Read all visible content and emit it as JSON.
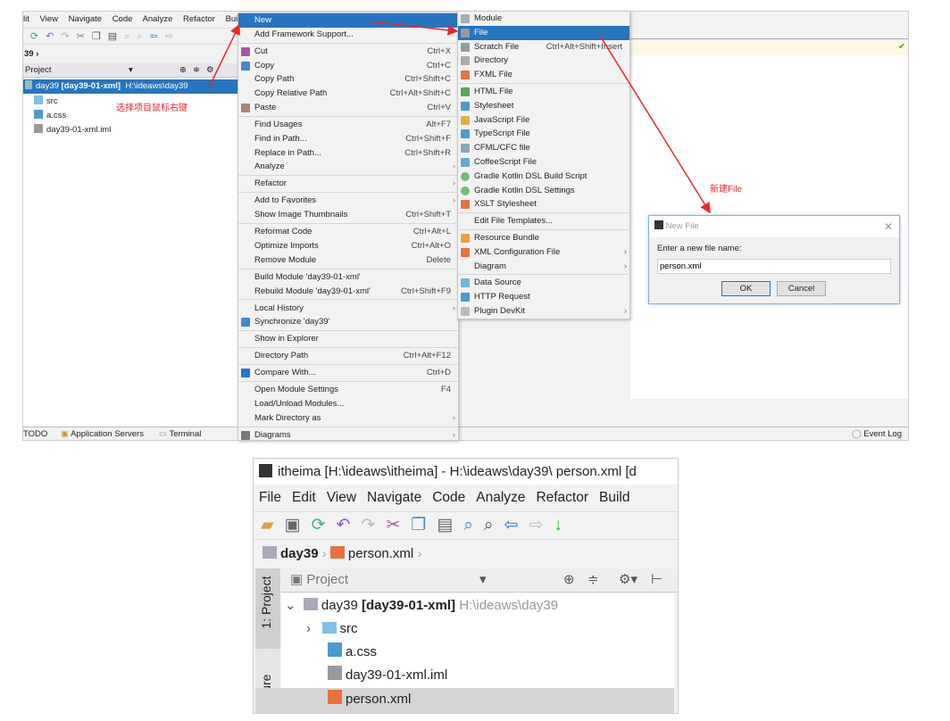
{
  "top_window": {
    "menubar": [
      "lit",
      "View",
      "Navigate",
      "Code",
      "Analyze",
      "Refactor",
      "Buil"
    ],
    "breadcrumb": "39",
    "project_header": "Project",
    "tree": {
      "root_name": "day39",
      "root_module": "[day39-01-xml]",
      "root_path": "H:\\ideaws\\day39",
      "items": [
        "src",
        "a.css",
        "day39-01-xml.iml"
      ]
    },
    "status_bar": {
      "todo": "TODO",
      "app_servers": "Application Servers",
      "terminal": "Terminal",
      "event_log": "Event Log"
    }
  },
  "context_menu": [
    {
      "label": "New",
      "arrow": true,
      "selected": true
    },
    {
      "label": "Add Framework Support..."
    },
    {
      "sep": true
    },
    {
      "label": "Cut",
      "shortcut": "Ctrl+X",
      "icon": "scissors-icon"
    },
    {
      "label": "Copy",
      "shortcut": "Ctrl+C",
      "icon": "copy-icon"
    },
    {
      "label": "Copy Path",
      "shortcut": "Ctrl+Shift+C"
    },
    {
      "label": "Copy Relative Path",
      "shortcut": "Ctrl+Alt+Shift+C"
    },
    {
      "label": "Paste",
      "shortcut": "Ctrl+V",
      "icon": "paste-icon"
    },
    {
      "sep": true
    },
    {
      "label": "Find Usages",
      "shortcut": "Alt+F7"
    },
    {
      "label": "Find in Path...",
      "shortcut": "Ctrl+Shift+F"
    },
    {
      "label": "Replace in Path...",
      "shortcut": "Ctrl+Shift+R"
    },
    {
      "label": "Analyze",
      "arrow": true
    },
    {
      "sep": true
    },
    {
      "label": "Refactor",
      "arrow": true
    },
    {
      "sep": true
    },
    {
      "label": "Add to Favorites",
      "arrow": true
    },
    {
      "label": "Show Image Thumbnails",
      "shortcut": "Ctrl+Shift+T"
    },
    {
      "sep": true
    },
    {
      "label": "Reformat Code",
      "shortcut": "Ctrl+Alt+L"
    },
    {
      "label": "Optimize Imports",
      "shortcut": "Ctrl+Alt+O"
    },
    {
      "label": "Remove Module",
      "shortcut": "Delete"
    },
    {
      "sep": true
    },
    {
      "label": "Build Module 'day39-01-xml'"
    },
    {
      "label": "Rebuild Module 'day39-01-xml'",
      "shortcut": "Ctrl+Shift+F9"
    },
    {
      "sep": true
    },
    {
      "label": "Local History",
      "arrow": true
    },
    {
      "label": "Synchronize 'day39'",
      "icon": "sync-icon"
    },
    {
      "sep": true
    },
    {
      "label": "Show in Explorer"
    },
    {
      "sep": true
    },
    {
      "label": "Directory Path",
      "shortcut": "Ctrl+Alt+F12"
    },
    {
      "sep": true
    },
    {
      "label": "Compare With...",
      "shortcut": "Ctrl+D",
      "icon": "compare-icon"
    },
    {
      "sep": true
    },
    {
      "label": "Open Module Settings",
      "shortcut": "F4"
    },
    {
      "label": "Load/Unload Modules..."
    },
    {
      "label": "Mark Directory as",
      "arrow": true
    },
    {
      "sep": true
    },
    {
      "label": "Diagrams",
      "arrow": true,
      "icon": "diagram-icon"
    }
  ],
  "new_submenu": [
    {
      "label": "Module",
      "icon": "module-icon"
    },
    {
      "label": "File",
      "selected": true,
      "icon": "file-icon"
    },
    {
      "label": "Scratch File",
      "shortcut": "Ctrl+Alt+Shift+Insert",
      "icon": "scratch-file-icon"
    },
    {
      "label": "Directory",
      "icon": "folder-icon"
    },
    {
      "label": "FXML File",
      "icon": "fxml-icon"
    },
    {
      "sep": true
    },
    {
      "label": "HTML File",
      "icon": "html-icon"
    },
    {
      "label": "Stylesheet",
      "icon": "css-icon"
    },
    {
      "label": "JavaScript File",
      "icon": "js-icon"
    },
    {
      "label": "TypeScript File",
      "icon": "ts-icon"
    },
    {
      "label": "CFML/CFC file",
      "icon": "cf-icon"
    },
    {
      "label": "CoffeeScript File",
      "icon": "coffee-icon"
    },
    {
      "label": "Gradle Kotlin DSL Build Script",
      "icon": "gradle-icon"
    },
    {
      "label": "Gradle Kotlin DSL Settings",
      "icon": "gradle-icon"
    },
    {
      "label": "XSLT Stylesheet",
      "icon": "xslt-icon"
    },
    {
      "sep": true
    },
    {
      "label": "Edit File Templates..."
    },
    {
      "sep": true
    },
    {
      "label": "Resource Bundle",
      "icon": "resource-bundle-icon"
    },
    {
      "label": "XML Configuration File",
      "arrow": true,
      "icon": "xml-icon"
    },
    {
      "label": "Diagram",
      "arrow": true
    },
    {
      "sep": true
    },
    {
      "label": "Data Source",
      "icon": "database-icon"
    },
    {
      "label": "HTTP Request",
      "icon": "api-icon"
    },
    {
      "label": "Plugin DevKit",
      "arrow": true,
      "icon": "plugin-icon"
    }
  ],
  "dialog": {
    "title": "New File",
    "label": "Enter a new file name:",
    "value": "person.xml",
    "ok": "OK",
    "cancel": "Cancel"
  },
  "annotations": {
    "right_click": "选择项目鼠标右键",
    "new_file": "新建File"
  },
  "bottom_window": {
    "title": "itheima [H:\\ideaws\\itheima] - H:\\ideaws\\day39\\ person.xml [d",
    "menubar": [
      "File",
      "Edit",
      "View",
      "Navigate",
      "Code",
      "Analyze",
      "Refactor",
      "Build"
    ],
    "breadcrumb": [
      "day39",
      "person.xml"
    ],
    "side_tabs": [
      "1: Project",
      "ucture"
    ],
    "project_header": "Project",
    "tree": {
      "root_name": "day39",
      "root_module": "[day39-01-xml]",
      "root_path": "H:\\ideaws\\day39",
      "items": [
        "src",
        "a.css",
        "day39-01-xml.iml",
        "person.xml"
      ]
    }
  },
  "colors": {
    "selection": "#2675bf",
    "annotation": "#e8262b"
  }
}
